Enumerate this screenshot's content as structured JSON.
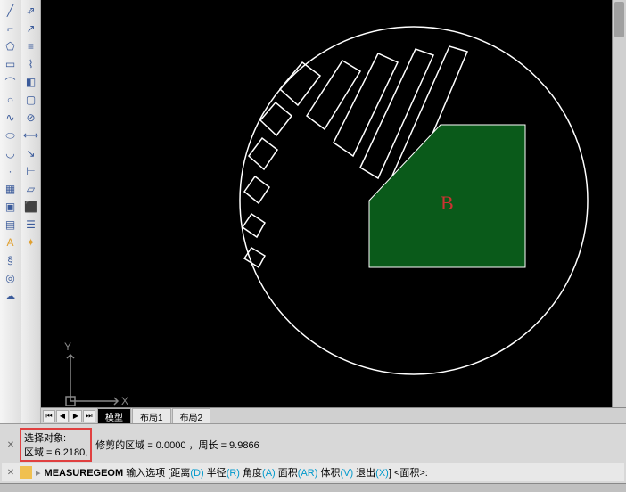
{
  "toolbars": {
    "left1_tips": [
      "line",
      "polyline",
      "polygon",
      "rectangle",
      "arc",
      "circle",
      "spline",
      "ellipse",
      "ellipse-arc",
      "point",
      "hatch",
      "region",
      "table",
      "mtext",
      "helix",
      "donut",
      "revision-cloud"
    ],
    "left2_tips": [
      "construction-line",
      "ray",
      "multiline",
      "3d-polyline",
      "gradient",
      "boundary",
      "wipeout",
      "dimension",
      "leader",
      "distance",
      "area",
      "mass-prop",
      "list",
      "id-point"
    ]
  },
  "canvas": {
    "ucs_y": "Y",
    "ucs_x": "X",
    "label_b": "B"
  },
  "tabs": {
    "model": "模型",
    "layout1": "布局1",
    "layout2": "布局2"
  },
  "status": {
    "select_obj": "选择对象:",
    "region_prefix": "区域 = ",
    "region_value": "6.2180",
    "trim_region": "修剪的区域 = 0.0000",
    "perimeter": "，周长 = 9.9866",
    "cmd_name": "MEASUREGEOM",
    "cmd_prompt1": "输入选项 [",
    "opt_distance": "距离",
    "opt_distance_k": "(D)",
    "opt_radius": "半径",
    "opt_radius_k": "(R)",
    "opt_angle": "角度",
    "opt_angle_k": "(A)",
    "opt_area": "面积",
    "opt_area_k": "(AR)",
    "opt_volume": "体积",
    "opt_volume_k": "(V)",
    "opt_exit": "退出",
    "opt_exit_k": "(X)",
    "cmd_prompt2": "] <面积>:"
  }
}
